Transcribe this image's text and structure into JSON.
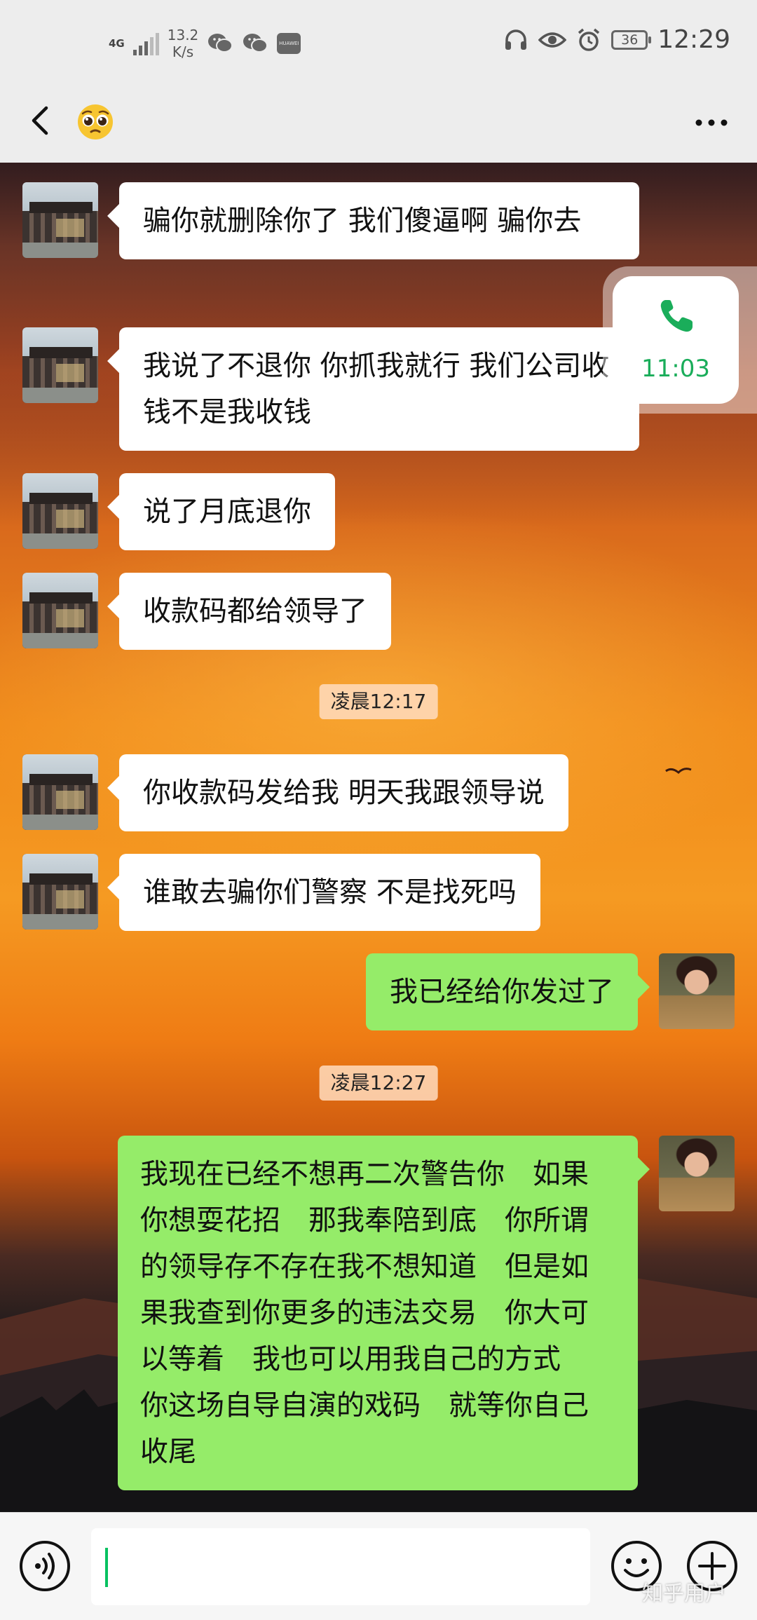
{
  "status_bar": {
    "network": "4G",
    "speed": "13.2",
    "speed_unit": "K/s",
    "app_badge": "HUAWEI",
    "battery": "36",
    "time": "12:29"
  },
  "header": {
    "title": "🥺",
    "icons": [
      "back-icon",
      "more-icon"
    ]
  },
  "call_float": {
    "duration": "11:03",
    "icon": "phone-icon",
    "color": "#1aad5a"
  },
  "messages": [
    {
      "side": "left",
      "avatar": "building",
      "text": "骗你就删除你了 我们傻逼啊 骗你去"
    },
    {
      "side": "left",
      "avatar": "building",
      "text": "我说了不退你 你抓我就行 我们公司收钱不是我收钱"
    },
    {
      "side": "left",
      "avatar": "building",
      "text": "说了月底退你"
    },
    {
      "side": "left",
      "avatar": "building",
      "text": "收款码都给领导了"
    },
    {
      "type": "time",
      "text": "凌晨12:17"
    },
    {
      "side": "left",
      "avatar": "building",
      "text": "你收款码发给我 明天我跟领导说"
    },
    {
      "side": "left",
      "avatar": "building",
      "text": "谁敢去骗你们警察 不是找死吗"
    },
    {
      "side": "right",
      "avatar": "lady",
      "text": "我已经给你发过了"
    },
    {
      "type": "time",
      "text": "凌晨12:27"
    },
    {
      "side": "right",
      "avatar": "lady",
      "text": "我现在已经不想再二次警告你　如果你想耍花招　那我奉陪到底　你所谓的领导存不存在我不想知道　但是如果我查到你更多的违法交易　你大可以等着　我也可以用我自己的方式　你这场自导自演的戏码　就等你自己收尾"
    }
  ],
  "input_bar": {
    "value": "",
    "icons": [
      "voice-icon",
      "emoji-icon",
      "add-icon"
    ]
  },
  "watermark": "知乎用户",
  "colors": {
    "bubble_self": "#95ec69",
    "bubble_other": "#ffffff",
    "accent": "#07c160"
  }
}
